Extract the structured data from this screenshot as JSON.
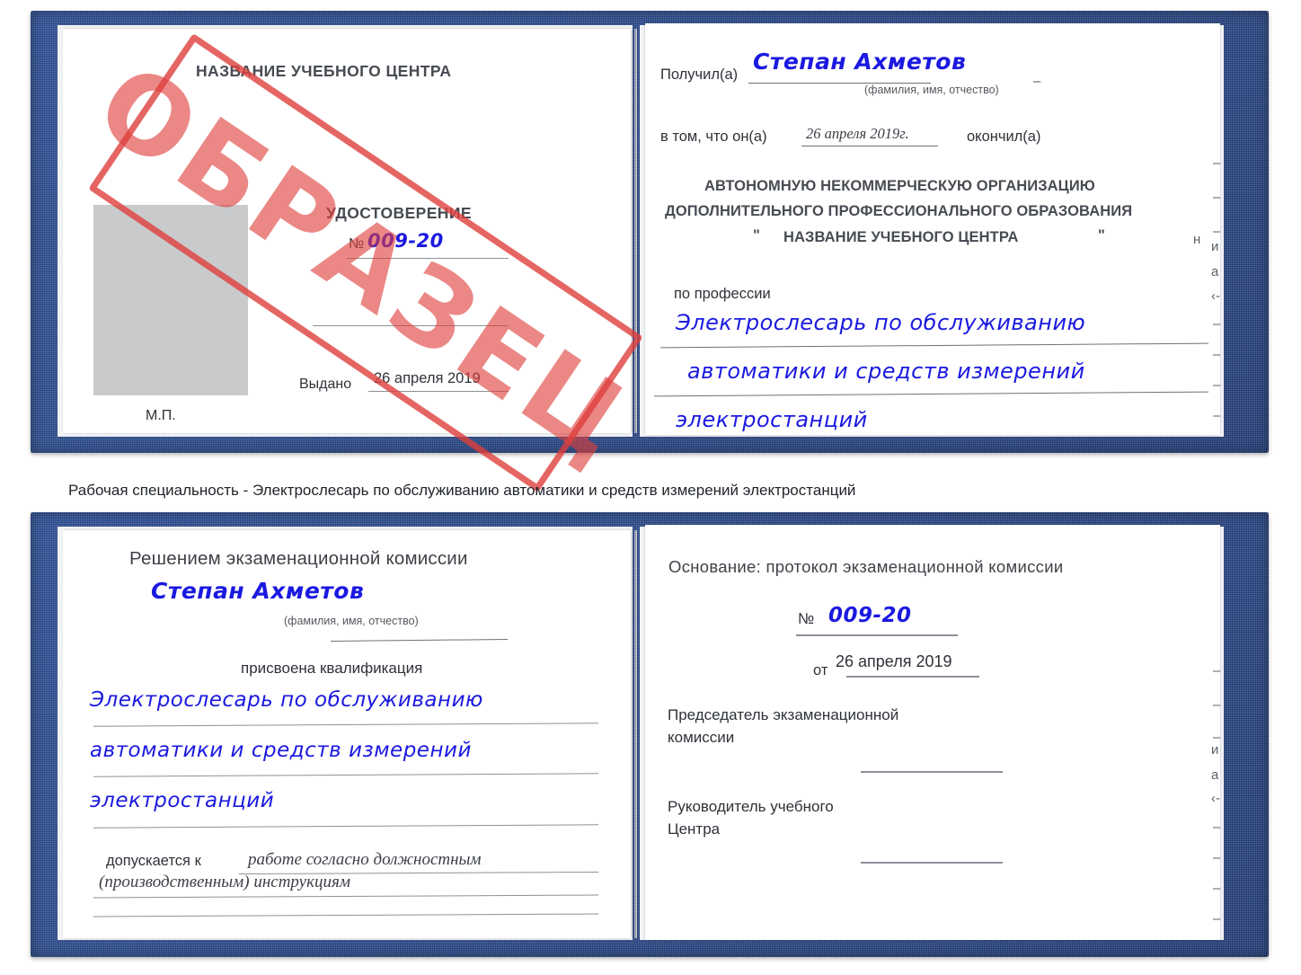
{
  "document": {
    "kind": "Удостоверение",
    "stamp_label": "ОБРАЗЕЦ",
    "colors": {
      "cover_blue": "#27478b",
      "handwriting_blue": "#1b19e0",
      "stamp_red": "#de3f3c",
      "photo_placeholder": "#c9cacc",
      "rule_gray": "#8d9199"
    }
  },
  "certificate_top": {
    "left_page": {
      "center_name": "НАЗВАНИЕ УЧЕБНОГО ЦЕНТРА",
      "title": "УДОСТОВЕРЕНИЕ",
      "number_label": "№",
      "number_value": "009-20",
      "issued_label": "Выдано",
      "issued_value": "26 апреля 2019",
      "seal_label": "М.П.",
      "photo_placeholder_name": "photo-placeholder"
    },
    "right_page": {
      "received_label": "Получил(а)",
      "received_value": "Степан Ахметов",
      "fio_hint": "(фамилия, имя, отчество)",
      "in_that_label": "в том, что он(а)",
      "in_that_date": "26 апреля 2019г.",
      "graduated_label": "окончил(а)",
      "org_line_1": "АВТОНОМНУЮ НЕКОММЕРЧЕСКУЮ ОРГАНИЗАЦИЮ",
      "org_line_2": "ДОПОЛНИТЕЛЬНОГО ПРОФЕССИОНАЛЬНОГО ОБРАЗОВАНИЯ",
      "org_quote_open": "\"",
      "org_line_3": "НАЗВАНИЕ УЧЕБНОГО ЦЕНТРА",
      "org_quote_close": "\"",
      "profession_label": "по профессии",
      "profession_line_1": "Электрослесарь по обслуживанию",
      "profession_line_2": "автоматики и средств измерений",
      "profession_line_3": "электростанций",
      "margin_fragments": [
        "–",
        "–",
        "–",
        "и",
        "а",
        "‹-",
        "–",
        "–",
        "–",
        "–"
      ]
    }
  },
  "caption": {
    "text": "Рабочая специальность - Электрослесарь по обслуживанию автоматики и средств измерений электростанций"
  },
  "certificate_bottom": {
    "left_page": {
      "heading": "Решением экзаменационной комиссии",
      "name_value": "Степан Ахметов",
      "fio_hint": "(фамилия, имя, отчество)",
      "qualification_label": "присвоена квалификация",
      "qualification_line_1": "Электрослесарь по обслуживанию",
      "qualification_line_2": "автоматики и средств измерений",
      "qualification_line_3": "электростанций",
      "admitted_label": "допускается к",
      "admitted_value_1": "работе согласно должностным",
      "admitted_value_2": "(производственным) инструкциям"
    },
    "right_page": {
      "basis_label": "Основание: протокол экзаменационной комиссии",
      "number_label": "№",
      "number_value": "009-20",
      "date_label": "от",
      "date_value": "26 апреля 2019",
      "chairman_line_1": "Председатель экзаменационной",
      "chairman_line_2": "комиссии",
      "head_line_1": "Руководитель учебного",
      "head_line_2": "Центра",
      "margin_fragments": [
        "–",
        "–",
        "–",
        "и",
        "а",
        "‹-",
        "–",
        "–",
        "–",
        "–"
      ]
    }
  }
}
